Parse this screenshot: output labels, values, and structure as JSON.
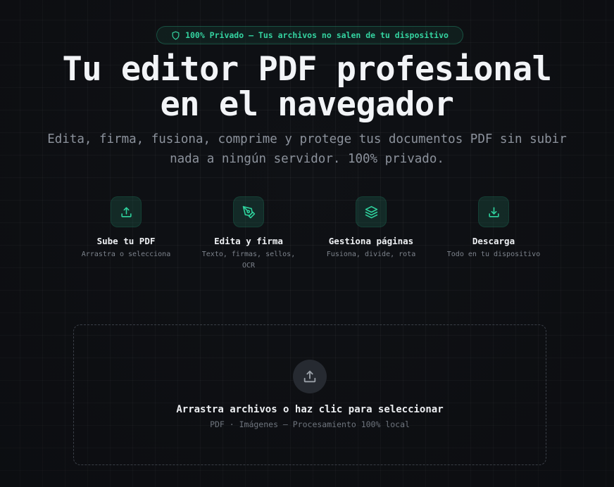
{
  "badge": {
    "icon": "shield-icon",
    "text": "100% Privado — Tus archivos no salen de tu dispositivo"
  },
  "hero": {
    "title_line1": "Tu editor PDF profesional",
    "title_line2": "en el navegador",
    "subtitle_line1": "Edita, firma, fusiona, comprime y protege tus documentos PDF sin subir",
    "subtitle_line2": "nada a ningún servidor. 100% privado."
  },
  "features": [
    {
      "icon": "upload-icon",
      "title": "Sube tu PDF",
      "desc": "Arrastra o selecciona"
    },
    {
      "icon": "pen-tool-icon",
      "title": "Edita y firma",
      "desc": "Texto, firmas, sellos, OCR"
    },
    {
      "icon": "layers-icon",
      "title": "Gestiona páginas",
      "desc": "Fusiona, divide, rota"
    },
    {
      "icon": "download-icon",
      "title": "Descarga",
      "desc": "Todo en tu dispositivo"
    }
  ],
  "dropzone": {
    "icon": "upload-icon",
    "title": "Arrastra archivos o haz clic para seleccionar",
    "subtitle": "PDF · Imágenes — Procesamiento 100% local"
  },
  "colors": {
    "accent": "#2fd39e",
    "background": "#0f1115"
  }
}
